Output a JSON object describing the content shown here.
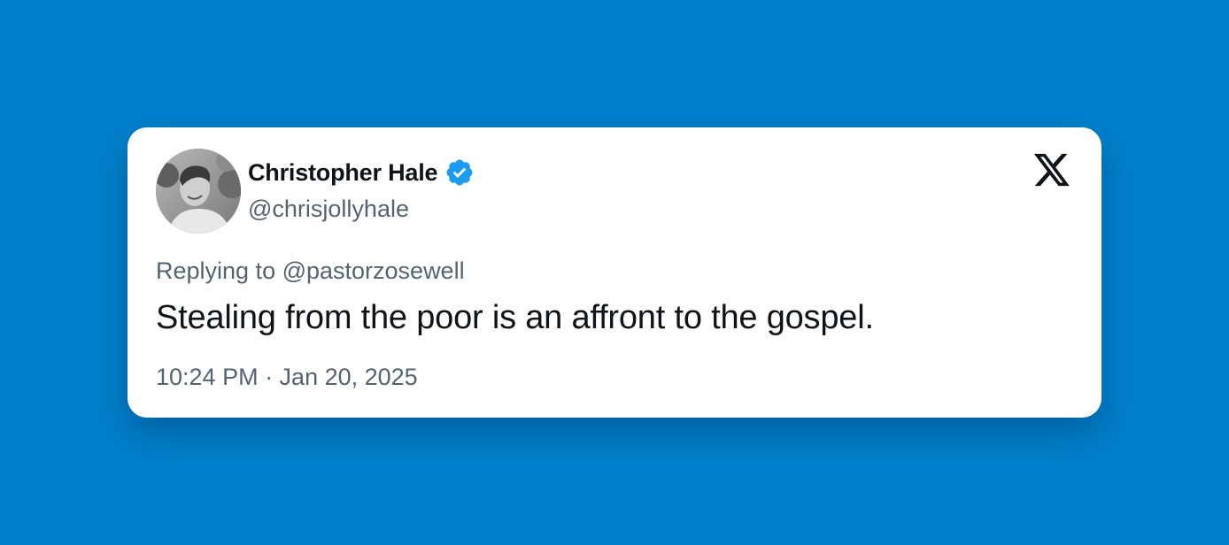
{
  "colors": {
    "background": "#0080CC",
    "card": "#FFFFFF",
    "verified_badge": "#1D9BF0",
    "primary_text": "#0F1419",
    "secondary_text": "#536471"
  },
  "tweet": {
    "author": {
      "display_name": "Christopher Hale",
      "handle": "@chrisjollyhale",
      "verified": true,
      "avatar_icon": "profile-photo"
    },
    "reply_line": "Replying to @pastorzosewell",
    "text": "Stealing from the poor is an affront to the gospel.",
    "timestamp": "10:24 PM · Jan 20, 2025",
    "platform_icon": "x-logo-icon"
  }
}
